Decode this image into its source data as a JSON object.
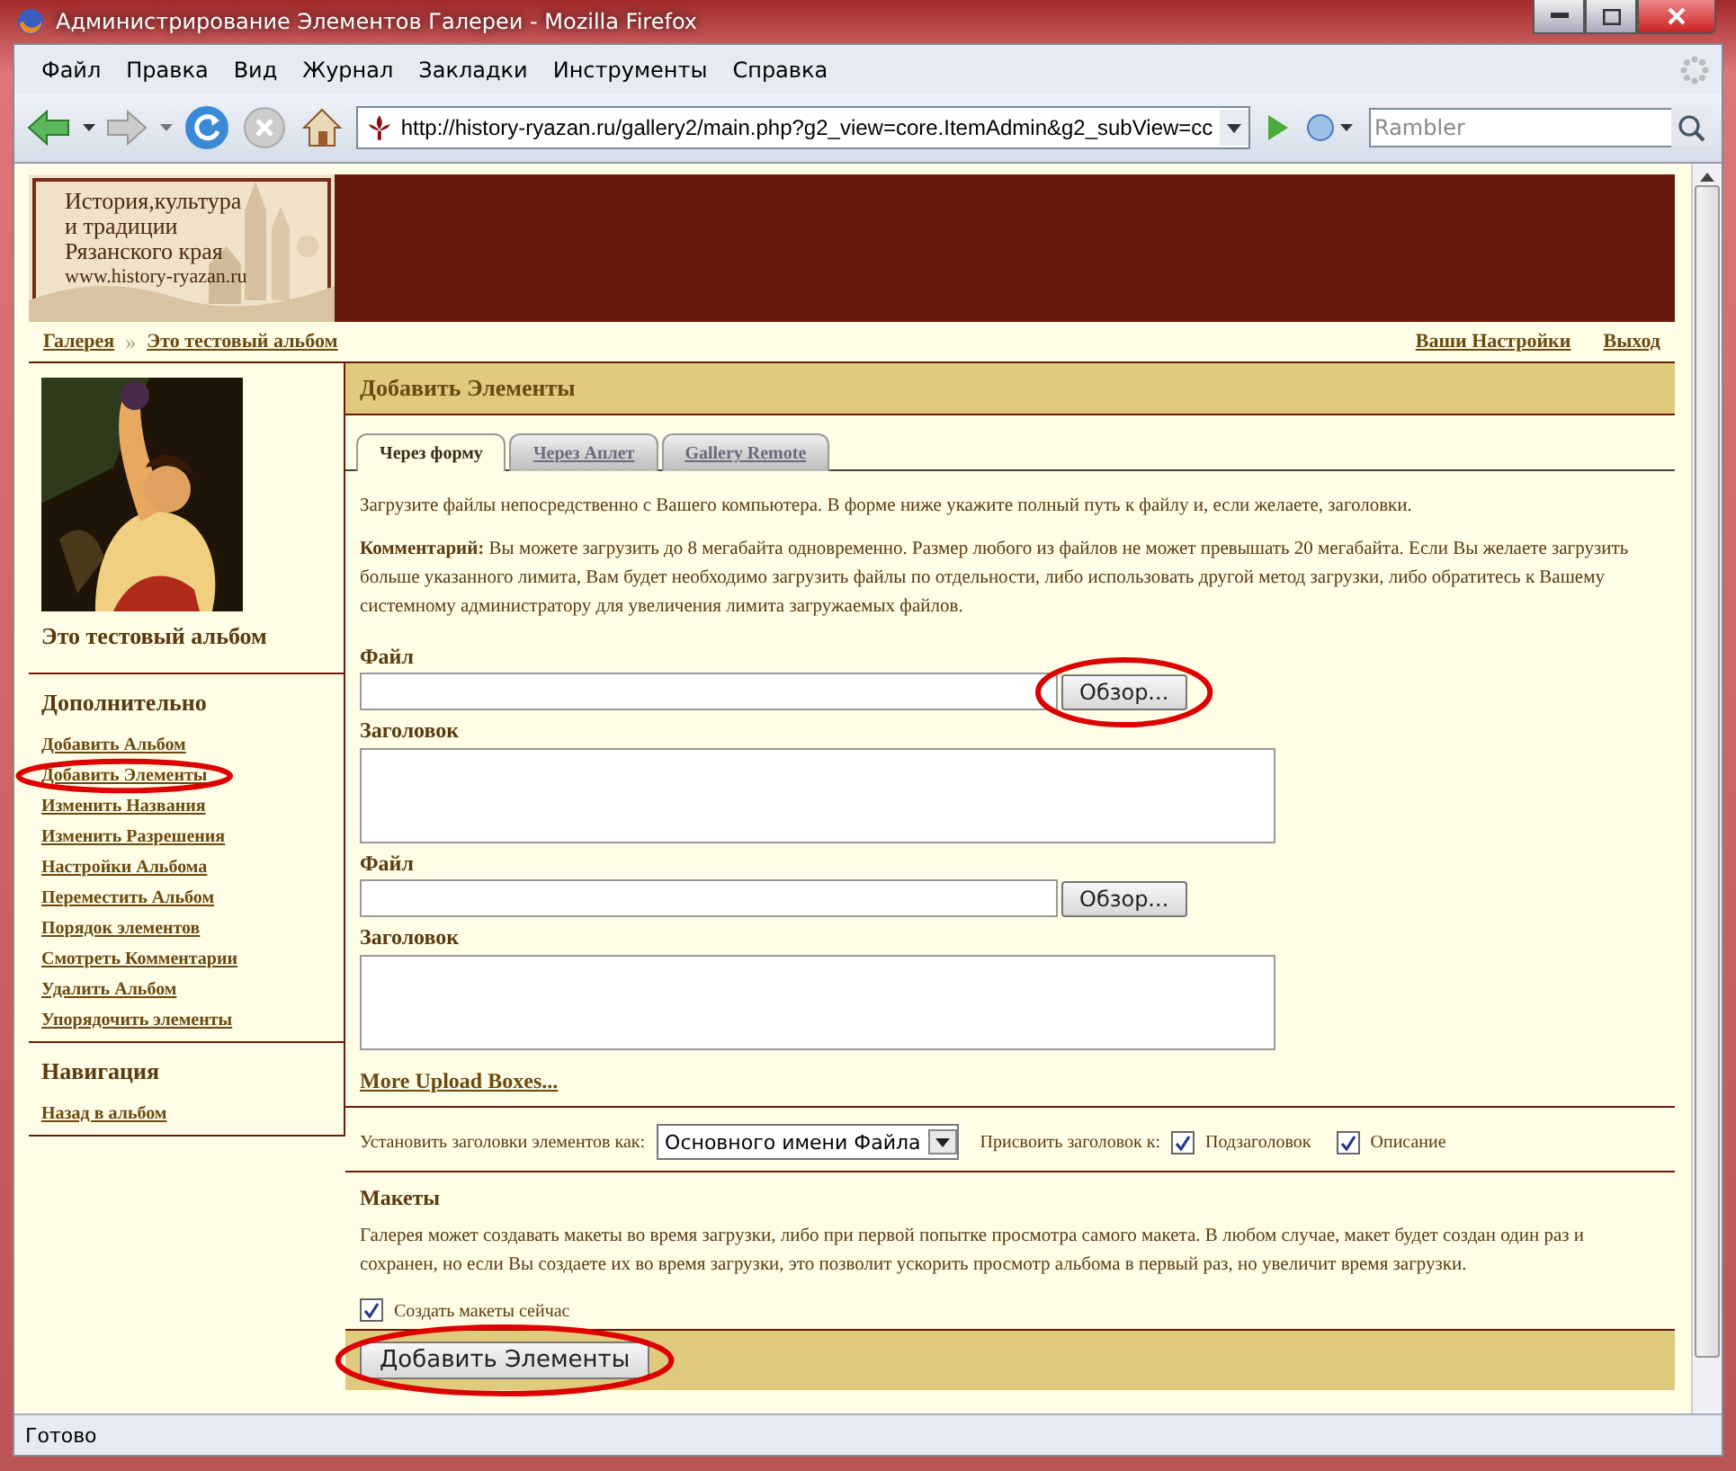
{
  "window": {
    "title": "Администрирование Элементов Галереи - Mozilla Firefox"
  },
  "menu": [
    "Файл",
    "Правка",
    "Вид",
    "Журнал",
    "Закладки",
    "Инструменты",
    "Справка"
  ],
  "address": {
    "url": "http://history-ryazan.ru/gallery2/main.php?g2_view=core.ItemAdmin&g2_subView=cc"
  },
  "search": {
    "placeholder": "Rambler"
  },
  "logo": {
    "lines": [
      "История,культура",
      "и традиции",
      "Рязанского края",
      "www.history-ryazan.ru"
    ]
  },
  "breadcrumb": [
    "Галерея",
    "Это тестовый альбом"
  ],
  "breadcrumb_separator": "»",
  "user_links": [
    "Ваши Настройки",
    "Выход"
  ],
  "album": {
    "title": "Это тестовый альбом"
  },
  "sidebar": [
    {
      "heading": "Дополнительно",
      "items": [
        {
          "label": "Добавить Альбом",
          "circled": false
        },
        {
          "label": "Добавить Элементы",
          "circled": true
        },
        {
          "label": "Изменить Названия",
          "circled": false
        },
        {
          "label": "Изменить Разрешения",
          "circled": false
        },
        {
          "label": "Настройки Альбома",
          "circled": false
        },
        {
          "label": "Переместить Альбом",
          "circled": false
        },
        {
          "label": "Порядок элементов",
          "circled": false
        },
        {
          "label": "Смотреть Комментарии",
          "circled": false
        },
        {
          "label": "Удалить Альбом",
          "circled": false
        },
        {
          "label": "Упорядочить элементы",
          "circled": false
        }
      ]
    },
    {
      "heading": "Навигация",
      "items": [
        {
          "label": "Назад в альбом",
          "circled": false
        }
      ]
    }
  ],
  "main": {
    "heading": "Добавить Элементы",
    "tabs": [
      {
        "label": "Через форму",
        "selected": true
      },
      {
        "label": "Через Аплет",
        "selected": false
      },
      {
        "label": "Gallery Remote",
        "selected": false
      }
    ],
    "intro": "Загрузите файлы непосредственно с Вашего компьютера. В форме ниже укажите полный путь к файлу и, если желаете, заголовки.",
    "comment": "**Комментарий:** Вы можете загрузить до 8 мегабайта одновременно. Размер любого из файлов не может превышать 20 мегабайта. Если Вы желаете загрузить больше указанного лимита, Вам будет необходимо загрузить файлы по отдельности, либо использовать другой метод загрузки, либо обратитесь к Вашему системному администратору для увеличения лимита загружаемых файлов.",
    "fields": [
      {
        "kind": "file",
        "label": "Файл",
        "button": "Обзор...",
        "circled": true
      },
      {
        "kind": "caption",
        "label": "Заголовок"
      },
      {
        "kind": "file",
        "label": "Файл",
        "button": "Обзор...",
        "circled": false
      },
      {
        "kind": "caption",
        "label": "Заголовок"
      }
    ],
    "more_link": "More Upload Boxes...",
    "caption_setting": {
      "label": "Установить заголовки элементов как:",
      "value": "Основного имени Файла",
      "assign_label": "Присвоить заголовок к:",
      "options": [
        {
          "label": "Подзаголовок",
          "checked": true
        },
        {
          "label": "Описание",
          "checked": true
        }
      ]
    },
    "thumbnails": {
      "heading": "Макеты",
      "text": "Галерея может создавать макеты во время загрузки, либо при первой попытке просмотра самого макета. В любом случае, макет будет создан один раз и сохранен, но если Вы создаете их во время загрузки, это позволит ускорить просмотр альбома в первый раз, но увеличит время загрузки.",
      "option": {
        "label": "Создать макеты сейчас",
        "checked": true
      }
    },
    "submit": {
      "label": "Добавить Элементы",
      "circled": true
    }
  },
  "status_bar": "Готово"
}
